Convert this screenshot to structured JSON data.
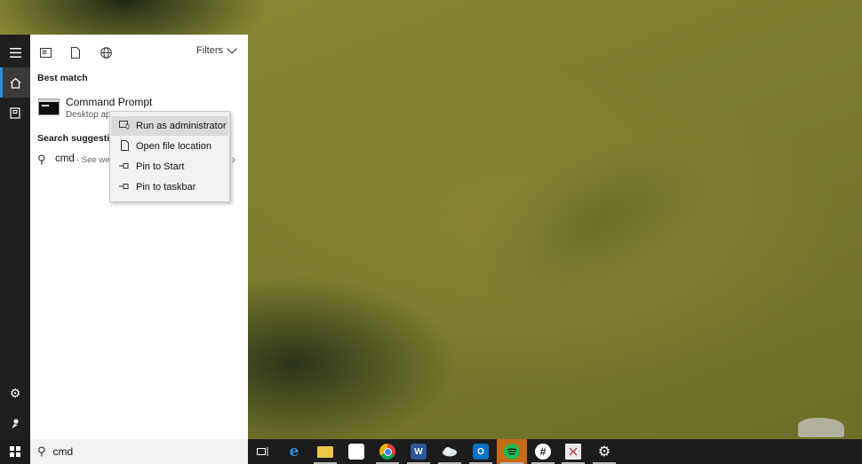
{
  "panel": {
    "filters_label": "Filters",
    "best_match_label": "Best match",
    "result": {
      "name": "Command Prompt",
      "subtitle": "Desktop app"
    },
    "suggestions_label": "Search suggestions",
    "suggestion": {
      "query": "cmd",
      "see_web": "- See web"
    }
  },
  "context_menu": {
    "items": [
      {
        "label": "Run as administrator",
        "icon": "shield-window-icon"
      },
      {
        "label": "Open file location",
        "icon": "file-icon"
      },
      {
        "label": "Pin to Start",
        "icon": "pin-icon"
      },
      {
        "label": "Pin to taskbar",
        "icon": "pin-icon"
      }
    ]
  },
  "search": {
    "value": "cmd"
  },
  "taskbar": {
    "apps": [
      {
        "name": "task-view",
        "icon": "task-view-icon"
      },
      {
        "name": "edge",
        "icon": "edge-icon"
      },
      {
        "name": "file-explorer",
        "icon": "folder-icon"
      },
      {
        "name": "store",
        "icon": "store-icon"
      },
      {
        "name": "chrome",
        "icon": "chrome-icon"
      },
      {
        "name": "word",
        "icon": "word-icon",
        "glyph": "W"
      },
      {
        "name": "mail-app",
        "icon": "cloud-icon"
      },
      {
        "name": "outlook",
        "icon": "outlook-icon",
        "glyph": "O"
      },
      {
        "name": "spotify",
        "icon": "spotify-icon"
      },
      {
        "name": "slack",
        "icon": "slack-icon"
      },
      {
        "name": "snipping-tool",
        "icon": "snipping-icon"
      },
      {
        "name": "settings",
        "icon": "gear-icon"
      }
    ]
  },
  "colors": {
    "accent": "#2f8fd8",
    "taskbar_bg": "#1c1c1c",
    "spotify_highlight": "#c86a12"
  }
}
